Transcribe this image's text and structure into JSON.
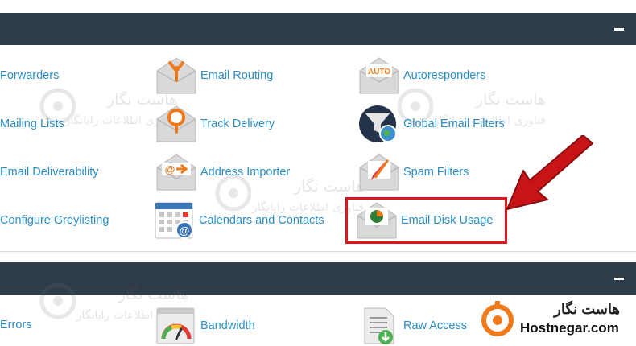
{
  "colors": {
    "header_bg": "#2f3c4b",
    "link": "#2b8fc4",
    "highlight": "#e0161c",
    "arrow": "#c81417",
    "brand_orange": "#f07a1a"
  },
  "section1": {
    "collapse_icon": "minus-icon",
    "items": [
      {
        "label": "Forwarders",
        "icon": "forwarders-icon"
      },
      {
        "label": "Email Routing",
        "icon": "email-routing-icon"
      },
      {
        "label": "Autoresponders",
        "icon": "autoresponders-icon",
        "badge": "AUTO"
      },
      {
        "label": "Mailing Lists",
        "icon": "mailing-lists-icon"
      },
      {
        "label": "Track Delivery",
        "icon": "track-delivery-icon"
      },
      {
        "label": "Global Email Filters",
        "icon": "global-email-filters-icon"
      },
      {
        "label": "Email Deliverability",
        "icon": "email-deliverability-icon"
      },
      {
        "label": "Address Importer",
        "icon": "address-importer-icon"
      },
      {
        "label": "Spam Filters",
        "icon": "spam-filters-icon"
      },
      {
        "label": "Configure Greylisting",
        "icon": "greylisting-icon"
      },
      {
        "label": "Calendars and Contacts",
        "icon": "calendar-icon"
      },
      {
        "label": "Email Disk Usage",
        "icon": "email-disk-usage-icon"
      }
    ]
  },
  "section2": {
    "collapse_icon": "minus-icon",
    "items": [
      {
        "label": "Errors",
        "icon": "errors-icon"
      },
      {
        "label": "Bandwidth",
        "icon": "bandwidth-icon"
      },
      {
        "label": "Raw Access",
        "icon": "raw-access-icon"
      }
    ]
  },
  "watermark": {
    "fa_title": "هاست نگار",
    "fa_sub": "فناوری اطلاعات رایانگار"
  },
  "brand": {
    "fa_name": "هاست نگار",
    "en_name": "Hostnegar.com"
  }
}
